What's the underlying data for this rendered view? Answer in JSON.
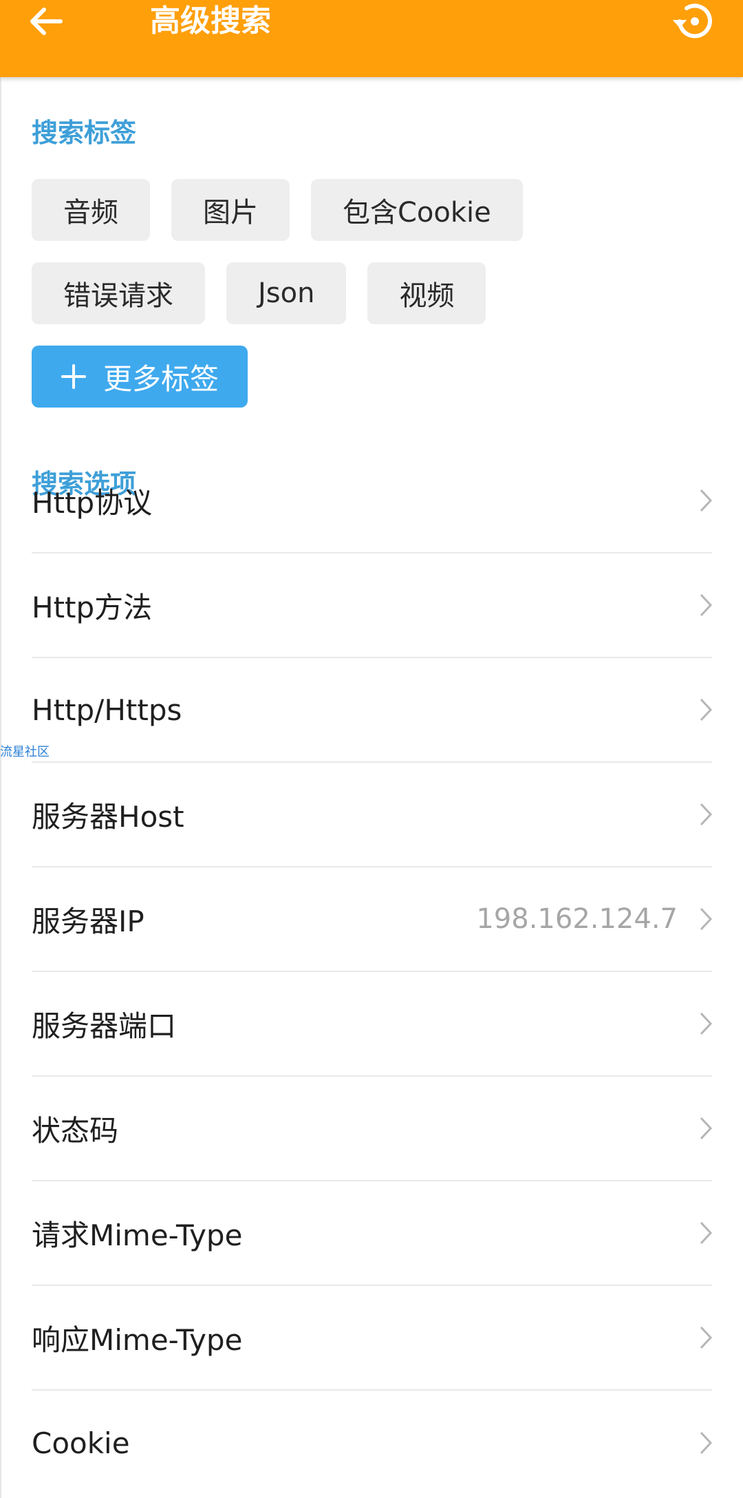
{
  "header": {
    "title": "高级搜索",
    "back_icon": "arrow-left-icon",
    "reset_icon": "reset-icon"
  },
  "colors": {
    "app_bar": "#FF9F0A",
    "section_title": "#3E9FD8",
    "more_chip": "#3FA9EE",
    "chip_bg": "#EEEEEE"
  },
  "tags_section": {
    "title": "搜索标签",
    "rows": [
      [
        "音频",
        "图片",
        "包含Cookie"
      ],
      [
        "错误请求",
        "Json",
        "视频"
      ]
    ],
    "more_label": "更多标签"
  },
  "options_section": {
    "title": "搜索选项",
    "items": [
      {
        "label": "Http协议",
        "value": ""
      },
      {
        "label": "Http方法",
        "value": ""
      },
      {
        "label": "Http/Https",
        "value": ""
      },
      {
        "label": "服务器Host",
        "value": ""
      },
      {
        "label": "服务器IP",
        "value": "198.162.124.7"
      },
      {
        "label": "服务器端口",
        "value": ""
      },
      {
        "label": "状态码",
        "value": ""
      },
      {
        "label": "请求Mime-Type",
        "value": ""
      },
      {
        "label": "响应Mime-Type",
        "value": ""
      },
      {
        "label": "Cookie",
        "value": ""
      }
    ]
  },
  "watermark": "流星社区"
}
